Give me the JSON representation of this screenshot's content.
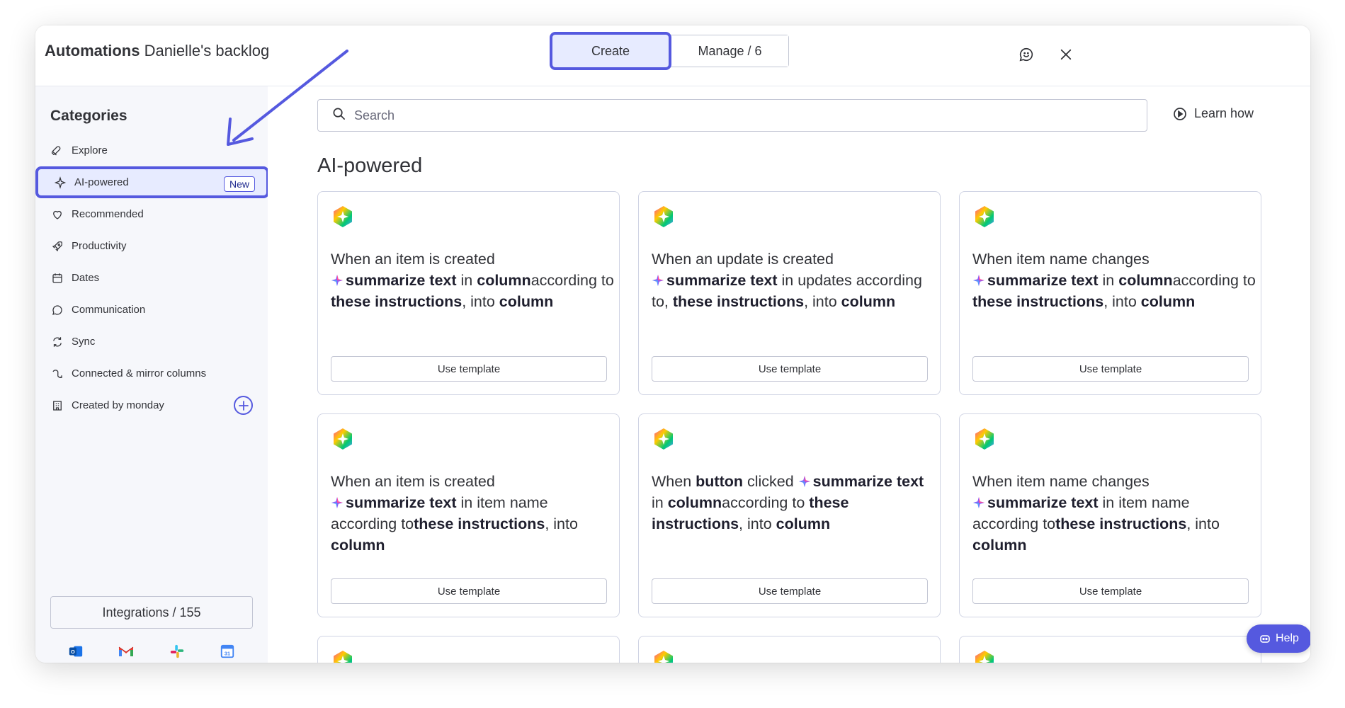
{
  "header": {
    "title_bold": "Automations",
    "title_rest": "Danielle's backlog",
    "tabs": [
      {
        "label": "Create"
      },
      {
        "label": "Manage / 6"
      }
    ]
  },
  "sidebar": {
    "title": "Categories",
    "items": [
      {
        "label": "Explore"
      },
      {
        "label": "AI-powered",
        "badge": "New"
      },
      {
        "label": "Recommended"
      },
      {
        "label": "Productivity"
      },
      {
        "label": "Dates"
      },
      {
        "label": "Communication"
      },
      {
        "label": "Sync"
      },
      {
        "label": "Connected & mirror columns"
      },
      {
        "label": "Created by monday"
      }
    ],
    "integrations_label": "Integrations / 155"
  },
  "main": {
    "search_placeholder": "Search",
    "learn_label": "Learn how",
    "section_title": "AI-powered",
    "use_label": "Use template",
    "help_label": "Help"
  },
  "cards": [
    [
      [
        "t",
        "When an item is created"
      ],
      [
        "br",
        ""
      ],
      [
        "s",
        ""
      ],
      [
        "b",
        "summarize text"
      ],
      [
        "t",
        " in "
      ],
      [
        "b",
        "column"
      ],
      [
        "t",
        "according to "
      ],
      [
        "b",
        "these instructions"
      ],
      [
        "t",
        ", into "
      ],
      [
        "b",
        "column"
      ]
    ],
    [
      [
        "t",
        "When an update is created"
      ],
      [
        "br",
        ""
      ],
      [
        "s",
        ""
      ],
      [
        "b",
        "summarize text"
      ],
      [
        "t",
        " in updates according to, "
      ],
      [
        "b",
        "these instructions"
      ],
      [
        "t",
        ", into "
      ],
      [
        "b",
        "column"
      ]
    ],
    [
      [
        "t",
        "When item name changes"
      ],
      [
        "br",
        ""
      ],
      [
        "s",
        ""
      ],
      [
        "b",
        "summarize text"
      ],
      [
        "t",
        " in "
      ],
      [
        "b",
        "column"
      ],
      [
        "t",
        "according to "
      ],
      [
        "b",
        "these instructions"
      ],
      [
        "t",
        ", into "
      ],
      [
        "b",
        "column"
      ]
    ],
    [
      [
        "t",
        "When an item is created"
      ],
      [
        "br",
        ""
      ],
      [
        "s",
        ""
      ],
      [
        "b",
        "summarize text"
      ],
      [
        "t",
        " in item name according to"
      ],
      [
        "b",
        "these instructions"
      ],
      [
        "t",
        ", into "
      ],
      [
        "b",
        "column"
      ]
    ],
    [
      [
        "t",
        "When "
      ],
      [
        "b",
        "button"
      ],
      [
        "t",
        " clicked "
      ],
      [
        "s",
        ""
      ],
      [
        "b",
        "summarize text"
      ],
      [
        "t",
        " in "
      ],
      [
        "b",
        "column"
      ],
      [
        "t",
        "according to "
      ],
      [
        "b",
        "these instructions"
      ],
      [
        "t",
        ", into "
      ],
      [
        "b",
        "column"
      ]
    ],
    [
      [
        "t",
        "When item name changes"
      ],
      [
        "br",
        ""
      ],
      [
        "s",
        ""
      ],
      [
        "b",
        "summarize text"
      ],
      [
        "t",
        " in item name according to"
      ],
      [
        "b",
        "these instructions"
      ],
      [
        "t",
        ", into "
      ],
      [
        "b",
        "column"
      ]
    ]
  ],
  "colors": {
    "accent": "#5559df",
    "selected_bg": "#e7ebff",
    "sidebar_bg": "#f6f7fb"
  }
}
